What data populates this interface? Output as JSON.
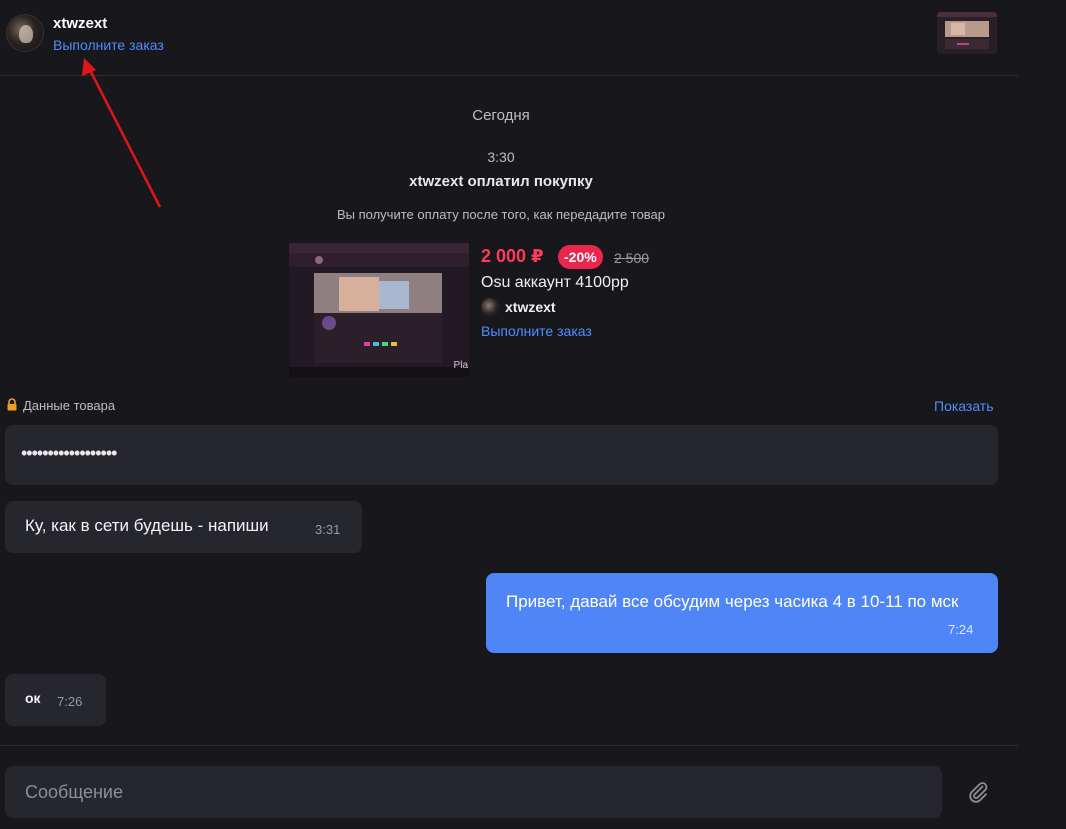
{
  "header": {
    "name": "xtwzext",
    "status_link": "Выполните заказ"
  },
  "chat": {
    "date_separator": "Сегодня",
    "system": {
      "time": "3:30",
      "title": "xtwzext оплатил покупку",
      "note": "Вы получите оплату после того, как передадите товар"
    },
    "product": {
      "price": "2 000 ₽",
      "discount": "-20%",
      "old_price": "2 500",
      "title": "Osu аккаунт 4100pp",
      "seller": "xtwzext",
      "action": "Выполните заказ",
      "thumb_caption": "Pla"
    },
    "product_data": {
      "label": "Данные товара",
      "show_link": "Показать",
      "masked_value": "••••••••••••••••••"
    },
    "messages": [
      {
        "direction": "incoming",
        "text": "Ку, как в сети будешь - напиши",
        "time": "3:31"
      },
      {
        "direction": "outgoing",
        "text": "Привет, давай все обсудим через часика 4 в 10-11 по мск",
        "time": "7:24"
      },
      {
        "direction": "incoming",
        "text": "ок",
        "time": "7:26"
      }
    ]
  },
  "composer": {
    "placeholder": "Сообщение"
  },
  "colors": {
    "background": "#18181c",
    "bubble_incoming": "#26262d",
    "bubble_outgoing": "#4f85f6",
    "link": "#4f8cff",
    "price": "#ff3b5c",
    "discount_badge": "#e8264e",
    "annotation_arrow": "#e0161b"
  },
  "icons": {
    "lock": "lock-icon",
    "attach": "paperclip-icon"
  }
}
